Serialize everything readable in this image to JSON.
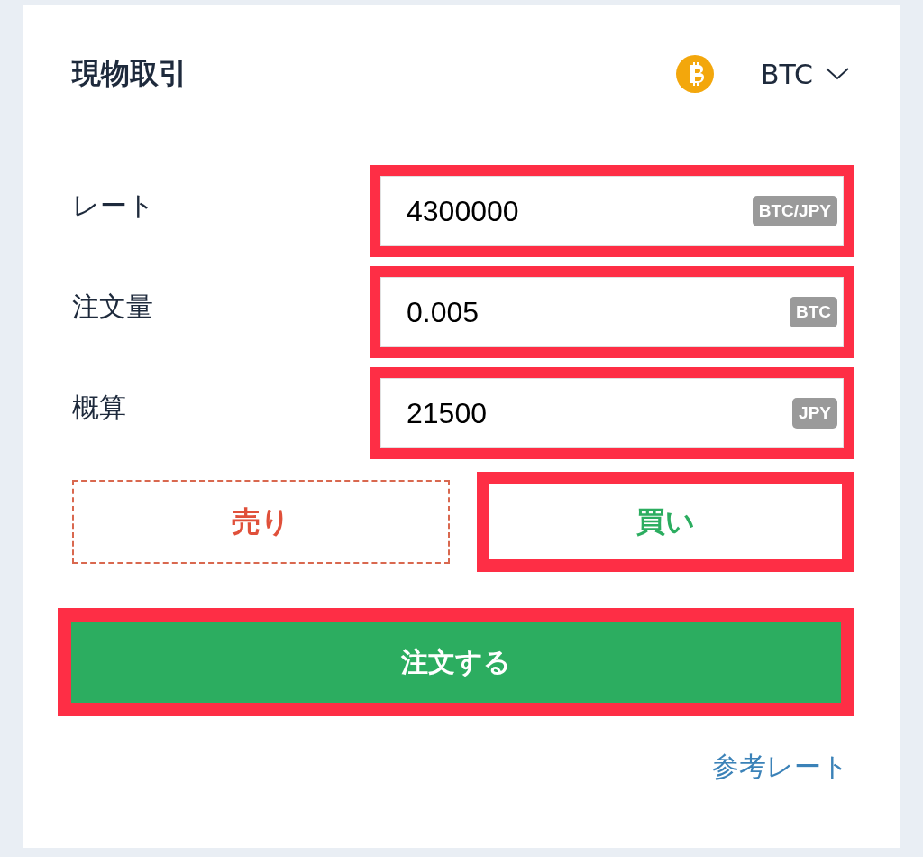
{
  "header": {
    "title": "現物取引",
    "currency": "BTC"
  },
  "fields": [
    {
      "label": "レート",
      "value": "4300000",
      "unit": "BTC/JPY",
      "highlighted": true
    },
    {
      "label": "注文量",
      "value": "0.005",
      "unit": "BTC",
      "highlighted": true
    },
    {
      "label": "概算",
      "value": "21500",
      "unit": "JPY",
      "highlighted": true
    }
  ],
  "sides": [
    {
      "label": "売り",
      "kind": "sell",
      "highlighted": false
    },
    {
      "label": "買い",
      "kind": "buy",
      "highlighted": true
    }
  ],
  "order_button": {
    "label": "注文する",
    "highlighted": true
  },
  "reference_link": "参考レート"
}
